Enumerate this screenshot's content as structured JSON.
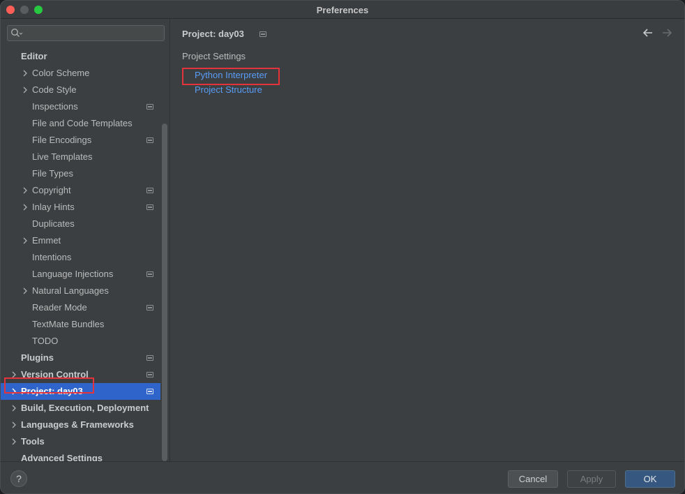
{
  "window": {
    "title": "Preferences"
  },
  "search": {
    "placeholder": ""
  },
  "sidebar": {
    "items": [
      {
        "label": "Editor",
        "level": 0,
        "bold": true,
        "chevron": false,
        "pin": false
      },
      {
        "label": "Color Scheme",
        "level": 1,
        "chevron": true,
        "pin": false
      },
      {
        "label": "Code Style",
        "level": 1,
        "chevron": true,
        "pin": false
      },
      {
        "label": "Inspections",
        "level": 1,
        "chevron": false,
        "pin": true
      },
      {
        "label": "File and Code Templates",
        "level": 1,
        "chevron": false,
        "pin": false
      },
      {
        "label": "File Encodings",
        "level": 1,
        "chevron": false,
        "pin": true
      },
      {
        "label": "Live Templates",
        "level": 1,
        "chevron": false,
        "pin": false
      },
      {
        "label": "File Types",
        "level": 1,
        "chevron": false,
        "pin": false
      },
      {
        "label": "Copyright",
        "level": 1,
        "chevron": true,
        "pin": true
      },
      {
        "label": "Inlay Hints",
        "level": 1,
        "chevron": true,
        "pin": true
      },
      {
        "label": "Duplicates",
        "level": 1,
        "chevron": false,
        "pin": false
      },
      {
        "label": "Emmet",
        "level": 1,
        "chevron": true,
        "pin": false
      },
      {
        "label": "Intentions",
        "level": 1,
        "chevron": false,
        "pin": false
      },
      {
        "label": "Language Injections",
        "level": 1,
        "chevron": false,
        "pin": true
      },
      {
        "label": "Natural Languages",
        "level": 1,
        "chevron": true,
        "pin": false
      },
      {
        "label": "Reader Mode",
        "level": 1,
        "chevron": false,
        "pin": true
      },
      {
        "label": "TextMate Bundles",
        "level": 1,
        "chevron": false,
        "pin": false
      },
      {
        "label": "TODO",
        "level": 1,
        "chevron": false,
        "pin": false
      },
      {
        "label": "Plugins",
        "level": 0,
        "bold": true,
        "chevron": false,
        "pin": true
      },
      {
        "label": "Version Control",
        "level": 0,
        "bold": true,
        "chevron": true,
        "pin": true
      },
      {
        "label": "Project: day03",
        "level": 0,
        "bold": true,
        "chevron": true,
        "pin": true,
        "selected": true
      },
      {
        "label": "Build, Execution, Deployment",
        "level": 0,
        "bold": true,
        "chevron": true,
        "pin": false
      },
      {
        "label": "Languages & Frameworks",
        "level": 0,
        "bold": true,
        "chevron": true,
        "pin": false
      },
      {
        "label": "Tools",
        "level": 0,
        "bold": true,
        "chevron": true,
        "pin": false
      },
      {
        "label": "Advanced Settings",
        "level": 0,
        "bold": true,
        "chevron": false,
        "pin": false
      }
    ]
  },
  "content": {
    "breadcrumb": "Project: day03",
    "section_title": "Project Settings",
    "links": [
      "Python Interpreter",
      "Project Structure"
    ]
  },
  "footer": {
    "help_label": "?",
    "cancel_label": "Cancel",
    "apply_label": "Apply",
    "ok_label": "OK"
  },
  "colors": {
    "selection": "#2f65ca",
    "link": "#589df6",
    "highlight_box": "#e5333b",
    "ok_button": "#365880"
  }
}
